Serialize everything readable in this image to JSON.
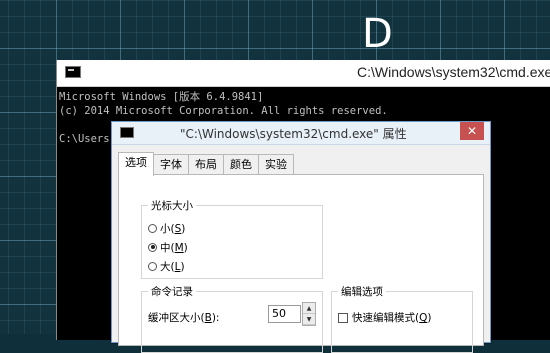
{
  "desktop": {
    "letter": "D"
  },
  "cmd": {
    "title": "C:\\Windows\\system32\\cmd.exe",
    "lines": [
      "Microsoft Windows [版本 6.4.9841]",
      "(c) 2014 Microsoft Corporation. All rights reserved.",
      "",
      "C:\\Users"
    ]
  },
  "dialog": {
    "title": "\"C:\\Windows\\system32\\cmd.exe\" 属性",
    "close_label": "✕",
    "tabs": [
      "选项",
      "字体",
      "布局",
      "颜色",
      "实验"
    ],
    "cursor_group": {
      "label": "光标大小",
      "options": [
        {
          "text": "小",
          "key": "S",
          "checked": false
        },
        {
          "text": "中",
          "key": "M",
          "checked": true
        },
        {
          "text": "大",
          "key": "L",
          "checked": false
        }
      ]
    },
    "history_group": {
      "label": "命令记录",
      "buffer_label": "缓冲区大小",
      "buffer_key": "B",
      "buffer_value": "50"
    },
    "edit_group": {
      "label": "编辑选项",
      "quick_edit_label": "快速编辑模式",
      "quick_edit_key": "Q"
    }
  }
}
